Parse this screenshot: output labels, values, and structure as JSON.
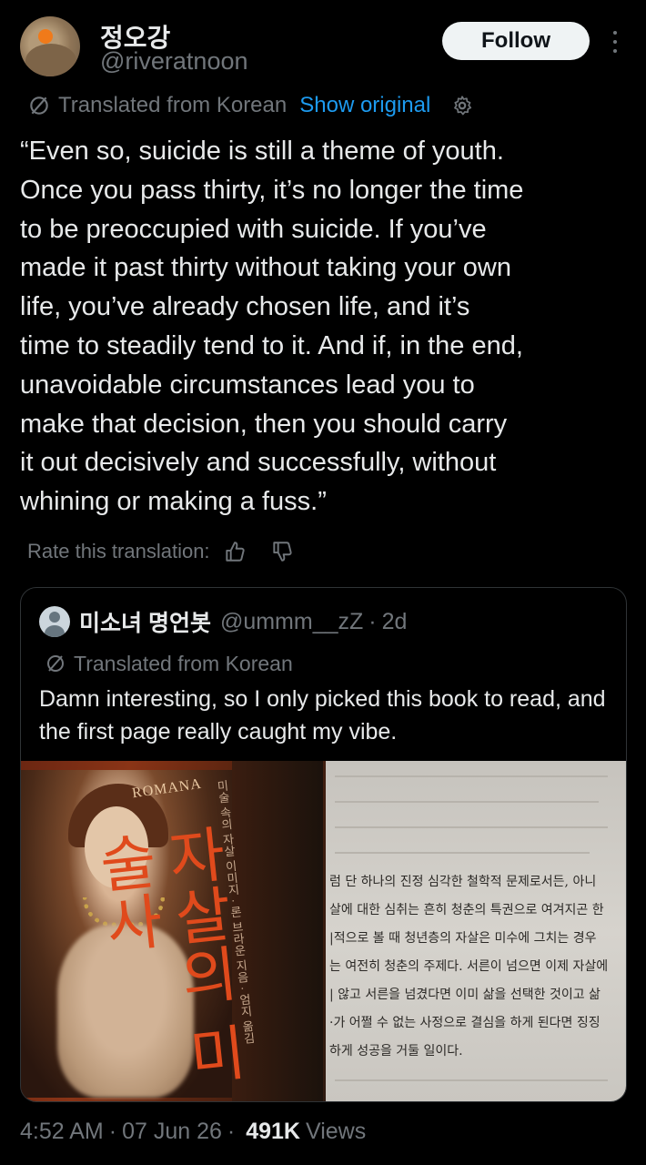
{
  "author": {
    "display_name": "정오강",
    "handle": "@riveratnoon",
    "follow_label": "Follow"
  },
  "translation": {
    "label": "Translated from Korean",
    "show_original": "Show original"
  },
  "tweet": {
    "text": "“Even so, suicide is still a theme of youth.\nOnce you pass thirty, it’s no longer the time\nto be preoccupied with suicide. If you’ve\nmade it past thirty without taking your own\nlife, you’ve already chosen life, and it’s\ntime to steadily tend to it. And if, in the end,\nunavoidable circumstances lead you to\nmake that decision, then you should carry\nit out decisively and successfully, without\nwhining or making a fuss.”"
  },
  "rate": {
    "label": "Rate this translation:"
  },
  "quote": {
    "display_name": "미소녀 명언봇",
    "handle": "@ummm__zZ",
    "separator": "·",
    "time": "2d",
    "translated_label": "Translated from Korean",
    "text": "Damn interesting, so I only picked this book to read, and the first page really caught my vibe.",
    "image": {
      "book_publisher": "ROMANA",
      "book_title": "자살의 미술사",
      "book_spine": "미술 속의 자살 이미지 · 론 브라운 지음 · 엄지 옮김",
      "page_lines": [
        "럼 단 하나의 진정 심각한 철학적 문제로서든, 아니",
        "살에 대한 심취는 흔히 청춘의 특권으로 여겨지곤 한",
        "|적으로 볼 때 청년층의 자살은 미수에 그치는 경우",
        "는 여전히 청춘의 주제다. 서른이 넘으면 이제 자살에",
        "| 않고 서른을 넘겼다면 이미 삶을 선택한 것이고 삶",
        "·가 어쩔 수 없는 사정으로 결심을 하게 된다면 징징",
        "하게 성공을 거둘 일이다."
      ]
    }
  },
  "meta": {
    "time": "4:52 AM",
    "date": "07 Jun 26",
    "separator": "·",
    "views_count": "491K",
    "views_label": "Views"
  }
}
